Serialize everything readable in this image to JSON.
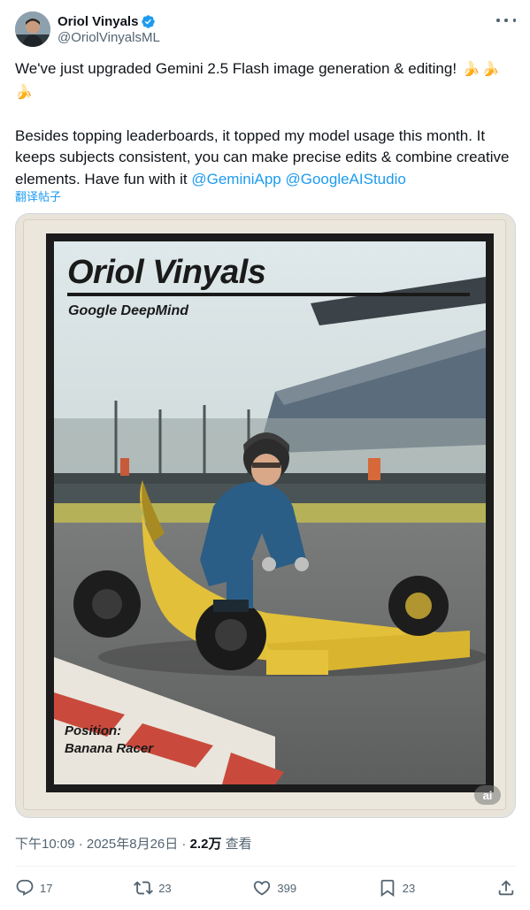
{
  "author": {
    "display_name": "Oriol Vinyals",
    "handle": "@OriolVinyalsML",
    "verified": true,
    "verified_color": "#1d9bf0"
  },
  "tweet": {
    "line1": "We've just upgraded Gemini 2.5 Flash image generation & editing!",
    "emoji": "🍌",
    "para2": "Besides topping leaderboards, it topped my model usage this month. It keeps subjects consistent, you can make precise edits & combine creative elements. Have fun with it ",
    "mention1": "@GeminiApp",
    "mention2": "@GoogleAIStudio",
    "translate": "翻译帖子"
  },
  "media": {
    "card_name": "Oriol Vinyals",
    "card_org": "Google DeepMind",
    "card_position_label": "Position:",
    "card_position_value": "Banana Racer",
    "ai_badge": "ai"
  },
  "meta": {
    "time": "下午10:09 · 2025年8月26日 · ",
    "views": "2.2万",
    "views_label": " 查看"
  },
  "actions": {
    "replies": "17",
    "reposts": "23",
    "likes": "399",
    "bookmarks": "23"
  },
  "colors": {
    "accent": "#1d9bf0",
    "secondary_text": "#536471",
    "primary_text": "#0f1419"
  }
}
